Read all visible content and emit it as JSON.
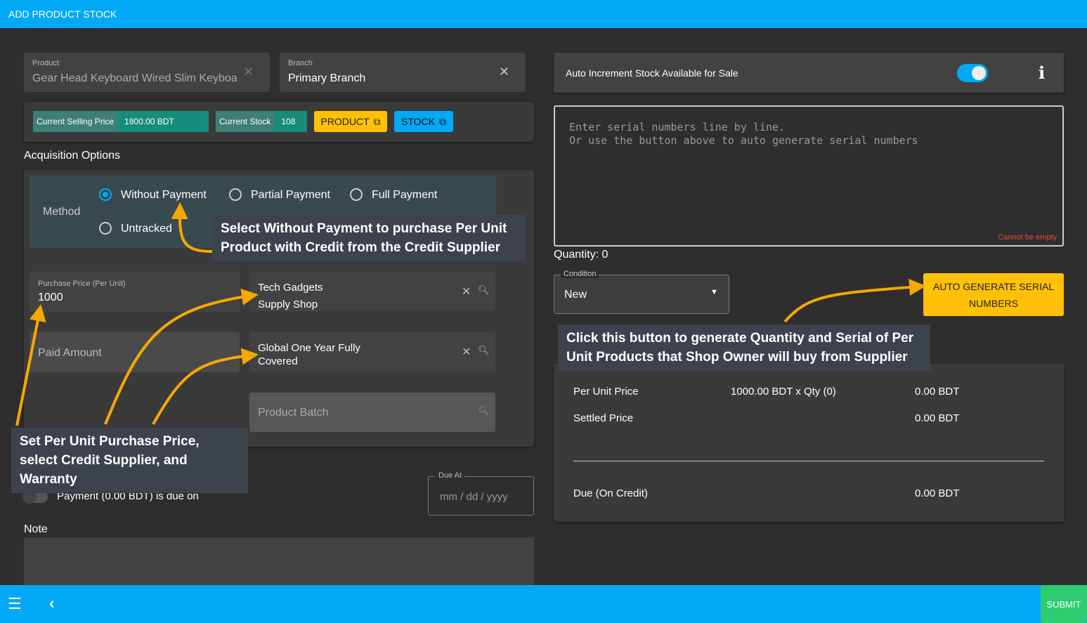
{
  "header": {
    "title": "ADD PRODUCT STOCK"
  },
  "product": {
    "label": "Product",
    "value": "Gear Head Keyboard Wired Slim Keyboard"
  },
  "branch": {
    "label": "Branch",
    "value": "Primary Branch"
  },
  "info": {
    "selling_price_label": "Current Selling Price",
    "selling_price": "1800.00 BDT",
    "stock_label": "Current Stock",
    "stock": "108",
    "product_btn": "PRODUCT",
    "stock_btn": "STOCK"
  },
  "acquisition": {
    "title": "Acquisition Options",
    "method_label": "Method",
    "options": [
      "Without Payment",
      "Partial Payment",
      "Full Payment",
      "Untracked"
    ],
    "selected": "Without Payment"
  },
  "purchase_price": {
    "label": "Purchase Price (Per Unit)",
    "value": "1000"
  },
  "paid_amount": {
    "placeholder": "Paid Amount"
  },
  "supplier": {
    "line1": "Tech Gadgets",
    "line2": "Supply Shop"
  },
  "warranty": {
    "line1": "Global One Year Fully",
    "line2": "Covered"
  },
  "batch": {
    "placeholder": "Product Batch"
  },
  "payment_due": {
    "label": "Payment (0.00 BDT) is due on",
    "due_label": "Due At",
    "due_placeholder": "mm / dd / yyyy"
  },
  "note": {
    "label": "Note"
  },
  "auto_increment": {
    "label": "Auto Increment Stock Available for Sale",
    "enabled": true
  },
  "serials": {
    "placeholder": "Enter serial numbers line by line.\nOr use the button above to auto generate serial numbers",
    "error": "Cannot be empty"
  },
  "quantity": "Quantity: 0",
  "condition": {
    "label": "Condition",
    "value": "New"
  },
  "auto_generate_btn": "AUTO GENERATE SERIAL NUMBERS",
  "summary": {
    "per_unit_label": "Per Unit Price",
    "per_unit_calc": "1000.00 BDT x Qty (0)",
    "per_unit_total": "0.00 BDT",
    "settled_label": "Settled Price",
    "settled": "0.00 BDT",
    "due_label": "Due (On Credit)",
    "due": "0.00 BDT"
  },
  "annotations": {
    "a1": "Select Without Payment to purchase Per Unit Product with Credit from the Credit Supplier",
    "a2": "Set Per Unit Purchase Price, select Credit Supplier, and Warranty",
    "a3": "Click this button to generate Quantity and Serial of Per Unit Products that Shop Owner will buy from Supplier"
  },
  "footer": {
    "submit": "SUBMIT"
  },
  "colors": {
    "primary": "#03a9f4",
    "accent": "#ffc107",
    "teal": "#178c7d",
    "submit": "#2ecc71",
    "arrow": "#f5a800"
  }
}
